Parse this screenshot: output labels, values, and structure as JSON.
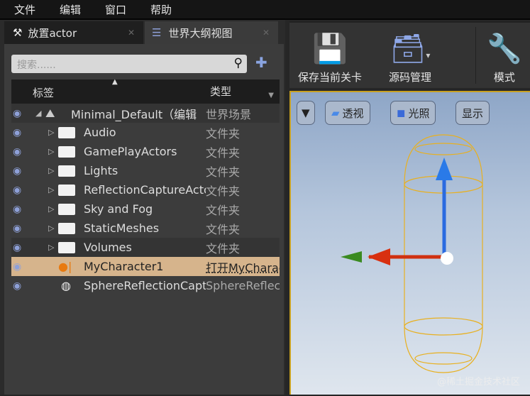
{
  "menu": [
    "文件",
    "编辑",
    "窗口",
    "帮助"
  ],
  "tabs": [
    {
      "label": "放置actor"
    },
    {
      "label": "世界大纲视图"
    }
  ],
  "search": {
    "placeholder": "搜索......"
  },
  "columns": {
    "label": "标签",
    "type": "类型"
  },
  "rows": [
    {
      "name": "Minimal_Default（编辑",
      "type": "世界场景"
    },
    {
      "name": "Audio",
      "type": "文件夹"
    },
    {
      "name": "GamePlayActors",
      "type": "文件夹"
    },
    {
      "name": "Lights",
      "type": "文件夹"
    },
    {
      "name": "ReflectionCaptureActors",
      "type": "文件夹"
    },
    {
      "name": "Sky and Fog",
      "type": "文件夹"
    },
    {
      "name": "StaticMeshes",
      "type": "文件夹"
    },
    {
      "name": "Volumes",
      "type": "文件夹"
    },
    {
      "name": "MyCharacter1",
      "type": "打开MyCharacter"
    },
    {
      "name": "SphereReflectionCapture",
      "type": "SphereReflectionCapture"
    }
  ],
  "toolbar": {
    "save": "保存当前关卡",
    "source": "源码管理",
    "modes": "模式"
  },
  "viewport": {
    "perspective": "透视",
    "lit": "光照",
    "show": "显示"
  },
  "watermark": "@稀土掘金技术社区"
}
